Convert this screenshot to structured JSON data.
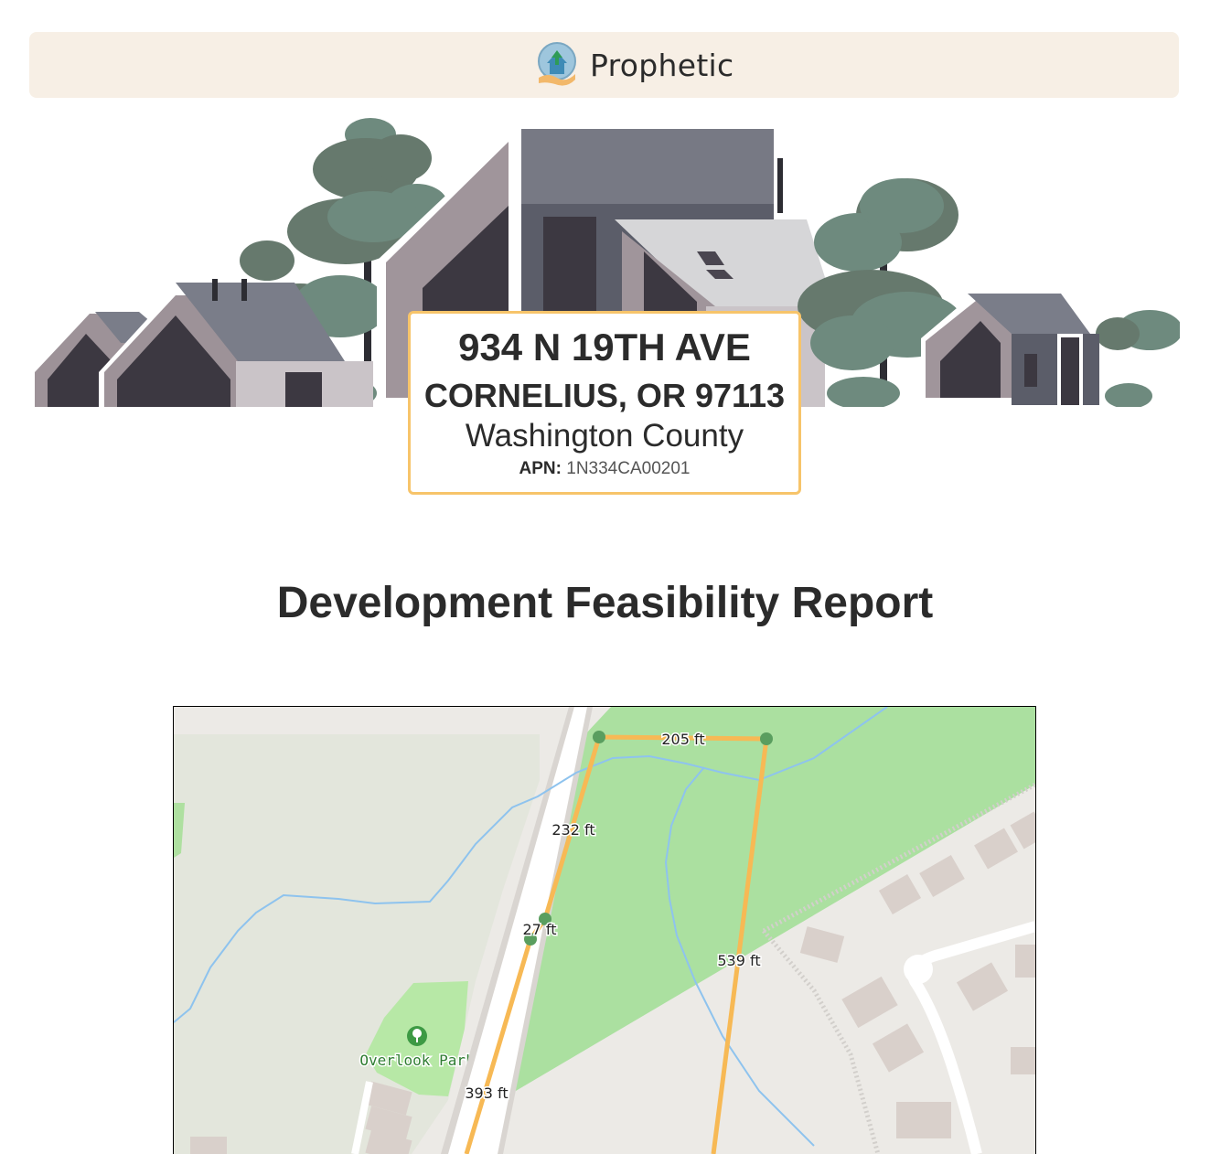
{
  "header": {
    "brand_name": "Prophetic"
  },
  "property": {
    "street": "934 N 19TH AVE",
    "city_state_zip": "CORNELIUS, OR 97113",
    "county": "Washington County",
    "apn_label": "APN:",
    "apn_value": "1N334CA00201"
  },
  "report": {
    "title": "Development Feasibility Report"
  },
  "map": {
    "park_name": "Overlook Park",
    "edge_labels": [
      "205 ft",
      "232 ft",
      "27 ft",
      "539 ft",
      "393 ft"
    ],
    "colors": {
      "parcel_outline": "#f7b955",
      "parcel_fill": "#aee0a0",
      "vertex": "#5a9e5f",
      "stream": "#8ec3ee"
    }
  }
}
